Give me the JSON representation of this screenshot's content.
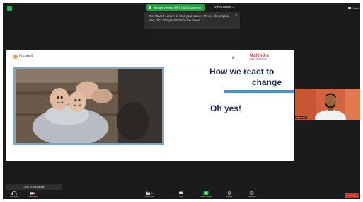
{
  "top_bar": {
    "share_banner": "You are viewing MPT 1665 1's screen",
    "view_options": "View Options ⌄",
    "view_label": "View"
  },
  "tooltip": {
    "text": "The shared content is fit to your screen. To see the original size, click \"Original Size\" in the menu."
  },
  "slide": {
    "logo_left": "Naandi",
    "logo_right_main": "Mahindra",
    "logo_right_sub": "RISE FOUNDATION",
    "small_mark": "&",
    "title_line1": "How we react to",
    "title_line2": "change",
    "subtitle": "Oh yes!",
    "colors": {
      "title": "#1d2a55",
      "accent_bar": "#4a8fd0",
      "photo_frame": "#7aa7c9"
    }
  },
  "participant": {
    "name": "MRITHUL"
  },
  "audio": {
    "join_label": "Click to join audio"
  },
  "toolbar": {
    "items": [
      {
        "label": "Join Audio",
        "icon": "headphones-icon"
      },
      {
        "label": "Start Video",
        "icon": "video-camera-icon"
      },
      {
        "label": "Participants",
        "icon": "participants-icon",
        "count": "10"
      },
      {
        "label": "Chat",
        "icon": "chat-icon"
      },
      {
        "label": "Share Screen",
        "icon": "share-screen-icon"
      },
      {
        "label": "Record",
        "icon": "record-icon"
      },
      {
        "label": "Reactions",
        "icon": "reactions-icon"
      }
    ],
    "end_label": "Leave"
  }
}
